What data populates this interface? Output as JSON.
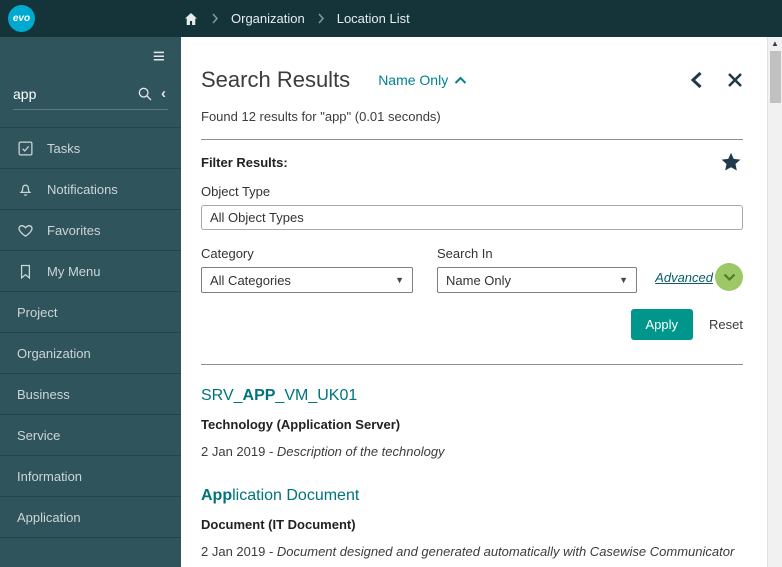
{
  "topbar": {
    "logo": "evo",
    "breadcrumb": {
      "items": [
        "Organization",
        "Location List"
      ]
    }
  },
  "sidebar": {
    "search": {
      "value": "app"
    },
    "items": [
      {
        "label": "Tasks",
        "icon": "tasks-icon"
      },
      {
        "label": "Notifications",
        "icon": "bell-icon"
      },
      {
        "label": "Favorites",
        "icon": "heart-icon"
      },
      {
        "label": "My Menu",
        "icon": "bookmark-icon"
      },
      {
        "label": "Project"
      },
      {
        "label": "Organization"
      },
      {
        "label": "Business"
      },
      {
        "label": "Service"
      },
      {
        "label": "Information"
      },
      {
        "label": "Application"
      }
    ]
  },
  "main": {
    "title": "Search Results",
    "scope_toggle": "Name Only",
    "found_text": "Found 12 results for \"app\" (0.01 seconds)",
    "filter": {
      "heading": "Filter Results:",
      "object_type_label": "Object Type",
      "object_type_value": "All Object Types",
      "category_label": "Category",
      "category_value": "All Categories",
      "search_in_label": "Search In",
      "search_in_value": "Name Only",
      "advanced_label": "Advanced",
      "apply_label": "Apply",
      "reset_label": "Reset"
    },
    "results": [
      {
        "title_pre": "SRV_",
        "title_match": "APP",
        "title_post": "_VM_UK01",
        "subtitle": "Technology (Application Server)",
        "date": "2 Jan 2019 - ",
        "description": "Description of the technology"
      },
      {
        "title_pre": "",
        "title_match": "App",
        "title_post": "lication Document",
        "subtitle": "Document (IT Document)",
        "date": "2 Jan 2019 - ",
        "description": "Document designed and generated automatically with Casewise Communicator"
      }
    ]
  },
  "glyphs": {
    "hamburger": "≡",
    "select_caret": "▼",
    "scroll_up_arrow": "▲",
    "sidebar_collapse": "‹"
  },
  "colors": {
    "topbar_bg": "#14343a",
    "sidebar_bg": "#2f545b",
    "logo_cyan": "#00a9cf",
    "accent_teal": "#00968b",
    "link_teal": "#00747c",
    "scope_teal": "#00838f",
    "advanced_green": "#9dc868",
    "star_navy": "#203a4c"
  }
}
